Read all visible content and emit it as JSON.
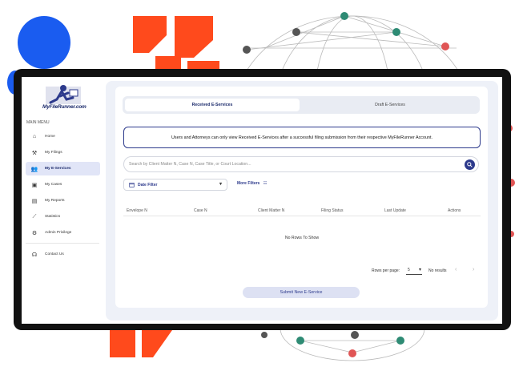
{
  "brand": {
    "logo_text": "MyFileRunner.com",
    "accent": "#2d3a8c",
    "decor_blue": "#1a5cf0",
    "decor_orange": "#ff4a1c"
  },
  "sidebar": {
    "menu_label": "MAIN MENU",
    "items": [
      {
        "label": "Home",
        "icon": "home-icon"
      },
      {
        "label": "My Filings",
        "icon": "gavel-icon"
      },
      {
        "label": "My E-Services",
        "icon": "users-icon"
      },
      {
        "label": "My Cases",
        "icon": "cases-icon"
      },
      {
        "label": "My Reports",
        "icon": "reports-icon"
      },
      {
        "label": "Statistics",
        "icon": "statistics-icon"
      },
      {
        "label": "Admin Privilege",
        "icon": "admin-icon"
      },
      {
        "label": "Contact Us",
        "icon": "headset-icon"
      }
    ],
    "active": "My E-Services"
  },
  "tabs": [
    {
      "label": "Received E-Services",
      "active": true
    },
    {
      "label": "Draft E-Services",
      "active": false
    }
  ],
  "notice": "Users and Attorneys can only view Received E-Services after a successful filing submission from their respective MyFileRunner Account.",
  "search": {
    "placeholder": "Search by Client Matter N, Case N, Case Title, or Court Location..."
  },
  "filters": {
    "date_filter": "Date Filter",
    "more_filters": "More Filters"
  },
  "table": {
    "columns": [
      "Envelope N",
      "Case N",
      "Client Matter N",
      "Filing Status",
      "Last Update",
      "Actions"
    ],
    "empty_text": "No Rows To Show"
  },
  "pagination": {
    "rows_per_page_label": "Rows per page:",
    "rows_per_page": "5",
    "results": "No results"
  },
  "submit_button": "Submit New E-Service"
}
